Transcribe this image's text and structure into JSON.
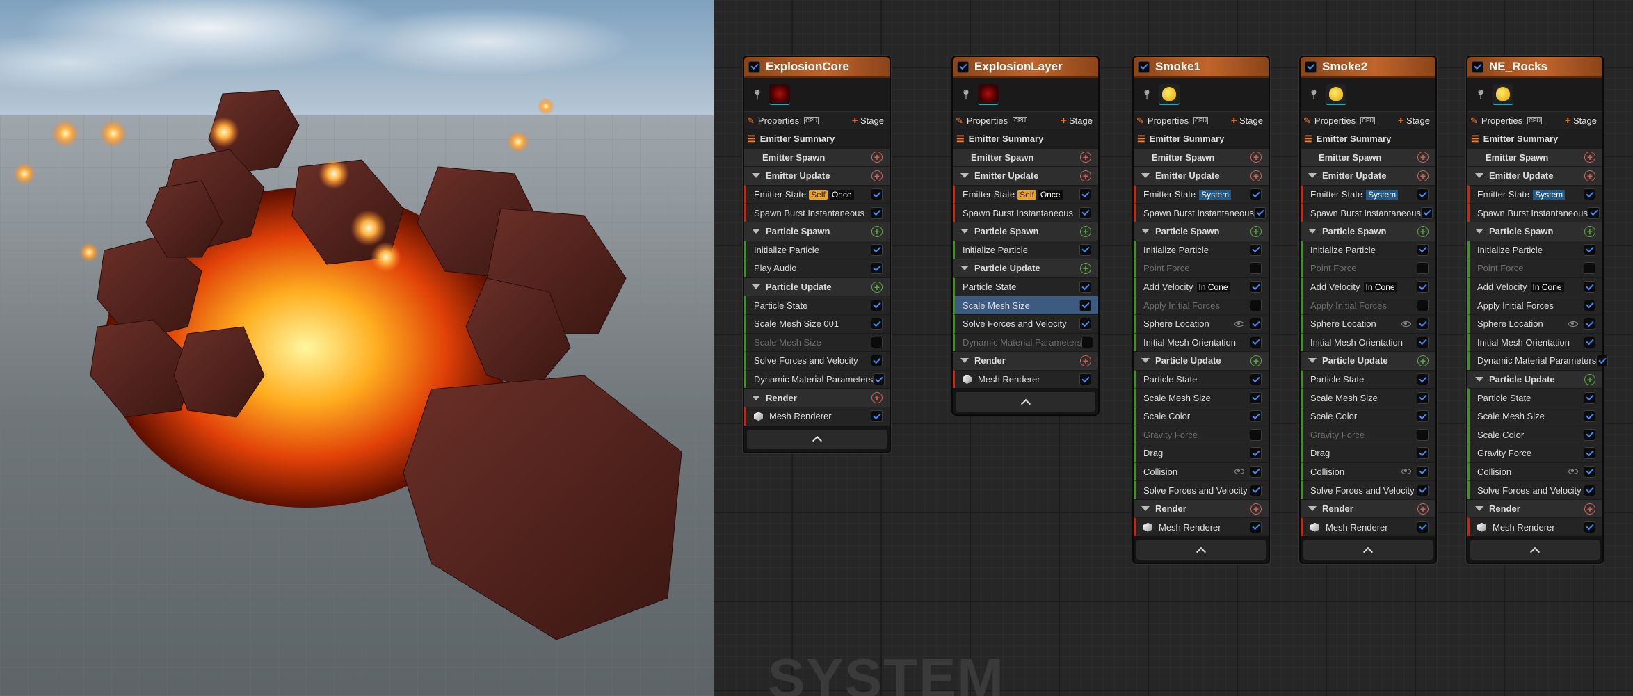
{
  "watermark": "SYSTEM",
  "emitters": [
    {
      "title": "ExplosionCore",
      "enabled": true,
      "thumb": "fire",
      "properties_label": "Properties",
      "cpu_label": "CPU",
      "stage_label": "Stage",
      "rows": [
        {
          "kind": "summary",
          "label": "Emitter Summary"
        },
        {
          "kind": "section",
          "label": "Emitter Spawn",
          "add": "red",
          "arrow": false
        },
        {
          "kind": "section",
          "label": "Emitter Update",
          "add": "red"
        },
        {
          "kind": "module",
          "label": "Emitter State",
          "tag_self": "Self",
          "tag_once": "Once",
          "checked": true,
          "bar": "red"
        },
        {
          "kind": "module",
          "label": "Spawn Burst Instantaneous",
          "checked": true,
          "bar": "red"
        },
        {
          "kind": "section",
          "label": "Particle Spawn",
          "add": "green"
        },
        {
          "kind": "module",
          "label": "Initialize Particle",
          "checked": true,
          "bar": "green"
        },
        {
          "kind": "module",
          "label": "Play Audio",
          "checked": true,
          "bar": "green"
        },
        {
          "kind": "section",
          "label": "Particle Update",
          "add": "green"
        },
        {
          "kind": "module",
          "label": "Particle State",
          "checked": true,
          "bar": "green"
        },
        {
          "kind": "module",
          "label": "Scale Mesh Size 001",
          "checked": true,
          "bar": "green"
        },
        {
          "kind": "module",
          "label": "Scale Mesh Size",
          "checked": false,
          "dim": true,
          "bar": "green"
        },
        {
          "kind": "module",
          "label": "Solve Forces and Velocity",
          "checked": true,
          "bar": "green"
        },
        {
          "kind": "module",
          "label": "Dynamic Material Parameters",
          "checked": true,
          "bar": "green"
        },
        {
          "kind": "section",
          "label": "Render",
          "add": "red"
        },
        {
          "kind": "render",
          "label": "Mesh Renderer",
          "checked": true
        }
      ]
    },
    {
      "title": "ExplosionLayer",
      "enabled": true,
      "thumb": "fire",
      "properties_label": "Properties",
      "cpu_label": "CPU",
      "stage_label": "Stage",
      "rows": [
        {
          "kind": "summary",
          "label": "Emitter Summary"
        },
        {
          "kind": "section",
          "label": "Emitter Spawn",
          "add": "red",
          "arrow": false
        },
        {
          "kind": "section",
          "label": "Emitter Update",
          "add": "red"
        },
        {
          "kind": "module",
          "label": "Emitter State",
          "tag_self": "Self",
          "tag_once": "Once",
          "checked": true,
          "bar": "red"
        },
        {
          "kind": "module",
          "label": "Spawn Burst Instantaneous",
          "checked": true,
          "bar": "red"
        },
        {
          "kind": "section",
          "label": "Particle Spawn",
          "add": "green"
        },
        {
          "kind": "module",
          "label": "Initialize Particle",
          "checked": true,
          "bar": "green"
        },
        {
          "kind": "section",
          "label": "Particle Update",
          "add": "green"
        },
        {
          "kind": "module",
          "label": "Particle State",
          "checked": true,
          "bar": "green"
        },
        {
          "kind": "module",
          "label": "Scale Mesh Size",
          "checked": true,
          "selected": true,
          "bar": "green"
        },
        {
          "kind": "module",
          "label": "Solve Forces and Velocity",
          "checked": true,
          "bar": "green"
        },
        {
          "kind": "module",
          "label": "Dynamic Material Parameters",
          "checked": false,
          "dim": true,
          "bar": "green"
        },
        {
          "kind": "section",
          "label": "Render",
          "add": "red"
        },
        {
          "kind": "render",
          "label": "Mesh Renderer",
          "checked": true
        }
      ]
    },
    {
      "title": "Smoke1",
      "enabled": true,
      "thumb": "smoke",
      "properties_label": "Properties",
      "cpu_label": "CPU",
      "stage_label": "Stage",
      "rows": [
        {
          "kind": "summary",
          "label": "Emitter Summary"
        },
        {
          "kind": "section",
          "label": "Emitter Spawn",
          "add": "red",
          "arrow": false
        },
        {
          "kind": "section",
          "label": "Emitter Update",
          "add": "red"
        },
        {
          "kind": "module",
          "label": "Emitter State",
          "tag_sys": "System",
          "checked": true,
          "bar": "red"
        },
        {
          "kind": "module",
          "label": "Spawn Burst Instantaneous",
          "checked": true,
          "bar": "red"
        },
        {
          "kind": "section",
          "label": "Particle Spawn",
          "add": "green"
        },
        {
          "kind": "module",
          "label": "Initialize Particle",
          "checked": true,
          "bar": "green"
        },
        {
          "kind": "module",
          "label": "Point Force",
          "checked": false,
          "dim": true,
          "bar": "green"
        },
        {
          "kind": "module",
          "label": "Add Velocity",
          "tag_cone": "In Cone",
          "checked": true,
          "bar": "green"
        },
        {
          "kind": "module",
          "label": "Apply Initial Forces",
          "checked": false,
          "dim": true,
          "bar": "green"
        },
        {
          "kind": "module",
          "label": "Sphere Location",
          "eye": true,
          "checked": true,
          "bar": "green"
        },
        {
          "kind": "module",
          "label": "Initial Mesh Orientation",
          "checked": true,
          "bar": "green"
        },
        {
          "kind": "section",
          "label": "Particle Update",
          "add": "green"
        },
        {
          "kind": "module",
          "label": "Particle State",
          "checked": true,
          "bar": "green"
        },
        {
          "kind": "module",
          "label": "Scale Mesh Size",
          "checked": true,
          "bar": "green"
        },
        {
          "kind": "module",
          "label": "Scale Color",
          "checked": true,
          "bar": "green"
        },
        {
          "kind": "module",
          "label": "Gravity Force",
          "checked": false,
          "dim": true,
          "bar": "green"
        },
        {
          "kind": "module",
          "label": "Drag",
          "checked": true,
          "bar": "green"
        },
        {
          "kind": "module",
          "label": "Collision",
          "eye": true,
          "checked": true,
          "bar": "green"
        },
        {
          "kind": "module",
          "label": "Solve Forces and Velocity",
          "checked": true,
          "bar": "green"
        },
        {
          "kind": "section",
          "label": "Render",
          "add": "red"
        },
        {
          "kind": "render",
          "label": "Mesh Renderer",
          "checked": true
        }
      ]
    },
    {
      "title": "Smoke2",
      "enabled": true,
      "thumb": "smoke",
      "properties_label": "Properties",
      "cpu_label": "CPU",
      "stage_label": "Stage",
      "rows": [
        {
          "kind": "summary",
          "label": "Emitter Summary"
        },
        {
          "kind": "section",
          "label": "Emitter Spawn",
          "add": "red",
          "arrow": false
        },
        {
          "kind": "section",
          "label": "Emitter Update",
          "add": "red"
        },
        {
          "kind": "module",
          "label": "Emitter State",
          "tag_sys": "System",
          "checked": true,
          "bar": "red"
        },
        {
          "kind": "module",
          "label": "Spawn Burst Instantaneous",
          "checked": true,
          "bar": "red"
        },
        {
          "kind": "section",
          "label": "Particle Spawn",
          "add": "green"
        },
        {
          "kind": "module",
          "label": "Initialize Particle",
          "checked": true,
          "bar": "green"
        },
        {
          "kind": "module",
          "label": "Point Force",
          "checked": false,
          "dim": true,
          "bar": "green"
        },
        {
          "kind": "module",
          "label": "Add Velocity",
          "tag_cone": "In Cone",
          "checked": true,
          "bar": "green"
        },
        {
          "kind": "module",
          "label": "Apply Initial Forces",
          "checked": false,
          "dim": true,
          "bar": "green"
        },
        {
          "kind": "module",
          "label": "Sphere Location",
          "eye": true,
          "checked": true,
          "bar": "green"
        },
        {
          "kind": "module",
          "label": "Initial Mesh Orientation",
          "checked": true,
          "bar": "green"
        },
        {
          "kind": "section",
          "label": "Particle Update",
          "add": "green"
        },
        {
          "kind": "module",
          "label": "Particle State",
          "checked": true,
          "bar": "green"
        },
        {
          "kind": "module",
          "label": "Scale Mesh Size",
          "checked": true,
          "bar": "green"
        },
        {
          "kind": "module",
          "label": "Scale Color",
          "checked": true,
          "bar": "green"
        },
        {
          "kind": "module",
          "label": "Gravity Force",
          "checked": false,
          "dim": true,
          "bar": "green"
        },
        {
          "kind": "module",
          "label": "Drag",
          "checked": true,
          "bar": "green"
        },
        {
          "kind": "module",
          "label": "Collision",
          "eye": true,
          "checked": true,
          "bar": "green"
        },
        {
          "kind": "module",
          "label": "Solve Forces and Velocity",
          "checked": true,
          "bar": "green"
        },
        {
          "kind": "section",
          "label": "Render",
          "add": "red"
        },
        {
          "kind": "render",
          "label": "Mesh Renderer",
          "checked": true
        }
      ]
    },
    {
      "title": "NE_Rocks",
      "enabled": true,
      "thumb": "smoke",
      "properties_label": "Properties",
      "cpu_label": "CPU",
      "stage_label": "Stage",
      "rows": [
        {
          "kind": "summary",
          "label": "Emitter Summary"
        },
        {
          "kind": "section",
          "label": "Emitter Spawn",
          "add": "red",
          "arrow": false
        },
        {
          "kind": "section",
          "label": "Emitter Update",
          "add": "red"
        },
        {
          "kind": "module",
          "label": "Emitter State",
          "tag_sys": "System",
          "checked": true,
          "bar": "red"
        },
        {
          "kind": "module",
          "label": "Spawn Burst Instantaneous",
          "checked": true,
          "bar": "red"
        },
        {
          "kind": "section",
          "label": "Particle Spawn",
          "add": "green"
        },
        {
          "kind": "module",
          "label": "Initialize Particle",
          "checked": true,
          "bar": "green"
        },
        {
          "kind": "module",
          "label": "Point Force",
          "checked": false,
          "dim": true,
          "bar": "green"
        },
        {
          "kind": "module",
          "label": "Add Velocity",
          "tag_cone": "In Cone",
          "checked": true,
          "bar": "green"
        },
        {
          "kind": "module",
          "label": "Apply Initial Forces",
          "checked": true,
          "bar": "green"
        },
        {
          "kind": "module",
          "label": "Sphere Location",
          "eye": true,
          "checked": true,
          "bar": "green"
        },
        {
          "kind": "module",
          "label": "Initial Mesh Orientation",
          "checked": true,
          "bar": "green"
        },
        {
          "kind": "module",
          "label": "Dynamic Material Parameters",
          "checked": true,
          "bar": "green"
        },
        {
          "kind": "section",
          "label": "Particle Update",
          "add": "green"
        },
        {
          "kind": "module",
          "label": "Particle State",
          "checked": true,
          "bar": "green"
        },
        {
          "kind": "module",
          "label": "Scale Mesh Size",
          "checked": true,
          "bar": "green"
        },
        {
          "kind": "module",
          "label": "Scale Color",
          "checked": true,
          "bar": "green"
        },
        {
          "kind": "module",
          "label": "Gravity Force",
          "checked": true,
          "bar": "green"
        },
        {
          "kind": "module",
          "label": "Collision",
          "eye": true,
          "checked": true,
          "bar": "green"
        },
        {
          "kind": "module",
          "label": "Solve Forces and Velocity",
          "checked": true,
          "bar": "green"
        },
        {
          "kind": "section",
          "label": "Render",
          "add": "red"
        },
        {
          "kind": "render",
          "label": "Mesh Renderer",
          "checked": true
        }
      ]
    }
  ],
  "colors": {
    "node_header": "#c0652b",
    "accent_orange": "#ff7a2a",
    "check_blue": "#3c8cff",
    "selected_row": "#3d5a80"
  },
  "icons": {
    "properties": "pencil-icon",
    "summary": "list-icon",
    "stage": "plus-icon",
    "collapse": "chevron-up-icon",
    "mesh": "cube-icon",
    "pin": "pin-icon",
    "visibility": "eye-icon"
  }
}
